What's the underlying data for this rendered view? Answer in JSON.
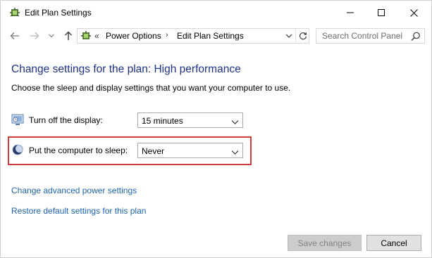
{
  "window": {
    "title": "Edit Plan Settings",
    "icon": "power-options-icon"
  },
  "titlebar": {
    "minimize_icon": "minimize-icon",
    "maximize_icon": "maximize-icon",
    "close_icon": "close-icon"
  },
  "address_bar": {
    "overflow": "«",
    "breadcrumbs": [
      "Power Options",
      "Edit Plan Settings"
    ],
    "separator": "›"
  },
  "search": {
    "placeholder": "Search Control Panel"
  },
  "main": {
    "heading": "Change settings for the plan: High performance",
    "subtitle": "Choose the sleep and display settings that you want your computer to use.",
    "settings": [
      {
        "label": "Turn off the display:",
        "value": "15 minutes",
        "icon": "display-icon"
      },
      {
        "label": "Put the computer to sleep:",
        "value": "Never",
        "icon": "sleep-moon-icon"
      }
    ],
    "links": {
      "advanced": "Change advanced power settings",
      "restore": "Restore default settings for this plan"
    }
  },
  "footer": {
    "save_label": "Save changes",
    "cancel_label": "Cancel"
  },
  "colors": {
    "heading": "#1e3287",
    "link": "#1c63b7",
    "highlight_border": "#d23b3b"
  }
}
